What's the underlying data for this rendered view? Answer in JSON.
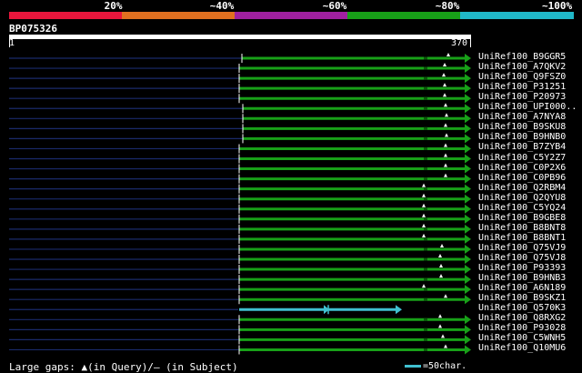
{
  "legend": {
    "colors": [
      "#e8163c",
      "#e07020",
      "#a020a0",
      "#18a018",
      "#20b8c8"
    ],
    "labels": [
      "20%",
      "~40%",
      "~60%",
      "~80%",
      "~100%"
    ]
  },
  "query": {
    "name": "BP075326",
    "start": "1",
    "end": "370"
  },
  "hits": [
    {
      "name": "UniRef100_B9GGR5",
      "type": "normal"
    },
    {
      "name": "UniRef100_A7QKV2",
      "type": "normal"
    },
    {
      "name": "UniRef100_Q9FSZ0",
      "type": "normal"
    },
    {
      "name": "UniRef100_P31251",
      "type": "normal"
    },
    {
      "name": "UniRef100_P20973",
      "type": "normal"
    },
    {
      "name": "UniRef100_UPI000..",
      "type": "normal"
    },
    {
      "name": "UniRef100_A7NYA8",
      "type": "normal"
    },
    {
      "name": "UniRef100_B9SKU8",
      "type": "normal"
    },
    {
      "name": "UniRef100_B9HNB0",
      "type": "normal"
    },
    {
      "name": "UniRef100_B7ZYB4",
      "type": "normal"
    },
    {
      "name": "UniRef100_C5Y2Z7",
      "type": "normal"
    },
    {
      "name": "UniRef100_C0P2X6",
      "type": "normal"
    },
    {
      "name": "UniRef100_C0PB96",
      "type": "normal"
    },
    {
      "name": "UniRef100_Q2RBM4",
      "type": "normal"
    },
    {
      "name": "UniRef100_Q2QYU8",
      "type": "normal"
    },
    {
      "name": "UniRef100_C5YQ24",
      "type": "normal"
    },
    {
      "name": "UniRef100_B9GBE8",
      "type": "normal"
    },
    {
      "name": "UniRef100_B8BNT8",
      "type": "normal"
    },
    {
      "name": "UniRef100_B8BNT1",
      "type": "normal"
    },
    {
      "name": "UniRef100_Q75VJ9",
      "type": "normal"
    },
    {
      "name": "UniRef100_Q75VJ8",
      "type": "normal"
    },
    {
      "name": "UniRef100_P93393",
      "type": "normal"
    },
    {
      "name": "UniRef100_B9HNB3",
      "type": "normal"
    },
    {
      "name": "UniRef100_A6N189",
      "type": "normal"
    },
    {
      "name": "UniRef100_B9SKZ1",
      "type": "normal"
    },
    {
      "name": "UniRef100_Q570K3",
      "type": "cyan"
    },
    {
      "name": "UniRef100_Q8RXG2",
      "type": "normal"
    },
    {
      "name": "UniRef100_P93028",
      "type": "normal"
    },
    {
      "name": "UniRef100_C5WNH5",
      "type": "normal"
    },
    {
      "name": "UniRef100_Q10MU6",
      "type": "normal"
    }
  ],
  "footer": {
    "gaps_text": "Large gaps: ▲(in Query)/— (in Subject)",
    "scale_text": "=50char.",
    "scale_color": "#40c0d0"
  },
  "colors": {
    "hit_line": "#18a018",
    "unaligned_line": "#1a2a6a",
    "cyan_hit": "#40c0d0"
  }
}
